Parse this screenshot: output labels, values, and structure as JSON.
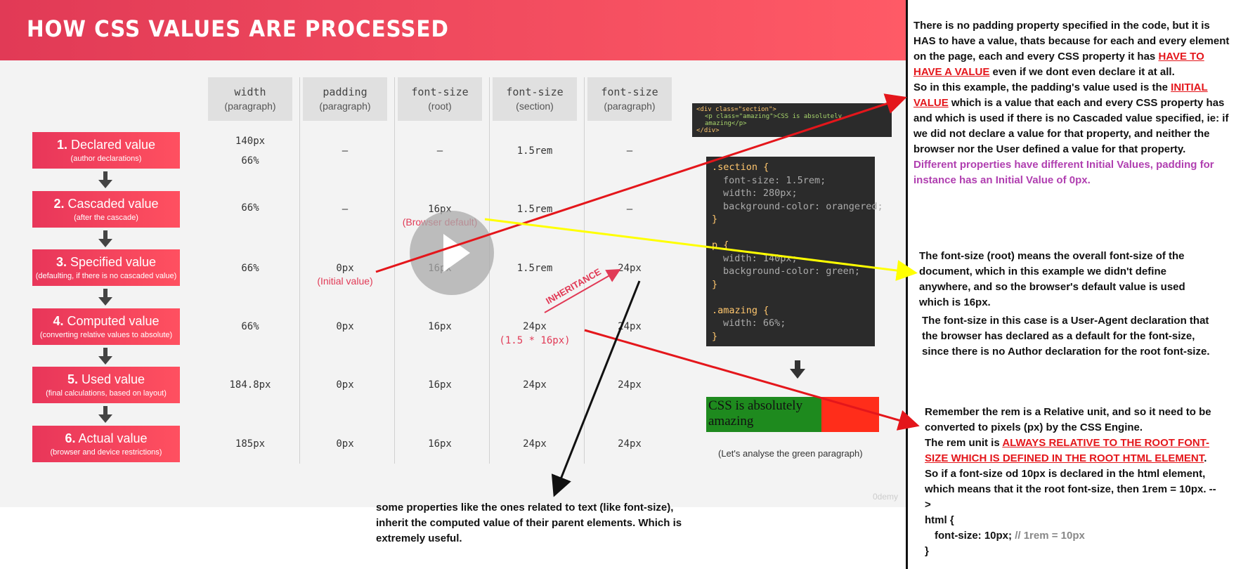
{
  "slide": {
    "title": "How CSS values are processed",
    "columns": [
      {
        "line1": "width",
        "line2": "(paragraph)"
      },
      {
        "line1": "padding",
        "line2": "(paragraph)"
      },
      {
        "line1": "font-size",
        "line2": "(root)"
      },
      {
        "line1": "font-size",
        "line2": "(section)"
      },
      {
        "line1": "font-size",
        "line2": "(paragraph)"
      }
    ],
    "stages": [
      {
        "name": "Declared value",
        "sub": "(author declarations)"
      },
      {
        "name": "Cascaded value",
        "sub": "(after the cascade)"
      },
      {
        "name": "Specified value",
        "sub": "(defaulting, if there is no cascaded value)"
      },
      {
        "name": "Computed value",
        "sub": "(converting relative values to absolute)"
      },
      {
        "name": "Used value",
        "sub": "(final calculations, based on layout)"
      },
      {
        "name": "Actual value",
        "sub": "(browser and device restrictions)"
      }
    ],
    "rows": [
      [
        "140px",
        "–",
        "–",
        "1.5rem",
        "–"
      ],
      [
        "66%",
        "–",
        "16px",
        "1.5rem",
        "–"
      ],
      [
        "66%",
        "0px",
        "16px",
        "1.5rem",
        "24px"
      ],
      [
        "66%",
        "0px",
        "16px",
        "24px",
        "24px"
      ],
      [
        "184.8px",
        "0px",
        "16px",
        "24px",
        "24px"
      ],
      [
        "185px",
        "0px",
        "16px",
        "24px",
        "24px"
      ]
    ],
    "declared_width_extra": "66%",
    "browser_default": "(Browser default)",
    "initial_value": "(Initial value)",
    "computed_formula": "(1.5 * 16px)",
    "inheritance": "INHERITANCE",
    "html_code": {
      "line1": "<div class=\"section\">",
      "line2": "<p class=\"amazing\">CSS is absolutely amazing</p>",
      "line3": "</div>"
    },
    "css_code": {
      "l1": ".section {",
      "l2": "font-size: 1.5rem;",
      "l3": "width: 280px;",
      "l4": "background-color: orangered;",
      "l5": "}",
      "l6": "p {",
      "l7": "width: 140px;",
      "l8": "background-color: green;",
      "l9": "}",
      "l10": ".amazing {",
      "l11": "width: 66%;",
      "l12": "}"
    },
    "result_text": "CSS is absolutely amazing",
    "caption": "(Let's analyse the green paragraph)",
    "watermark": "0demy"
  },
  "notes": {
    "n1_a": "There is no padding property specified in the code, but it is HAS to have a value, thats because for each and every element on the page, each and every CSS property it has",
    "n1_red1": "HAVE TO HAVE A VALUE",
    "n1_b": "even if we dont even declare it at all.",
    "n1_c": "So in this example, the padding's value used is the",
    "n1_red2": "INITIAL VALUE",
    "n1_d": "which is a value that each and every CSS property has and which is used if there is no Cascaded value specified, ie: if we did not declare a value for that property, and neither the browser nor the User defined a value for that property.",
    "n1_purple": "Different properties have different Initial Values, padding for instance has an Initial Value of 0px.",
    "n2": "The font-size (root) means the overall font-size of the document, which in this example we didn't define anywhere, and so the browser's default value is used which is 16px.",
    "n3": "The font-size in this case is a User-Agent declaration that the browser has declared as a default for the font-size, since there is no Author declaration for the root font-size.",
    "n4_a": "Remember the rem is a Relative unit, and so it need to be converted to pixels (px) by the CSS Engine.",
    "n4_b": "The rem unit is",
    "n4_red": "ALWAYS RELATIVE TO THE ROOT FONT-SIZE WHICH IS DEFINED IN THE ROOT HTML ELEMENT",
    "n4_c": "So if a font-size od 10px is declared in the html element, which means that it the root font-size, then 1rem = 10px. -->",
    "n4_d": "html {",
    "n4_e": "font-size: 10px;",
    "n4_comment": "// 1rem = 10px",
    "n4_f": "}",
    "bottom": "some properties like the ones related to text (like font-size), inherit the computed value of their parent elements. Which is extremely useful."
  },
  "colors": {
    "accent": "#e13a56",
    "annotation_red": "#e4161b",
    "annotation_yellow": "#ffff00",
    "purple": "#b03fb0"
  }
}
